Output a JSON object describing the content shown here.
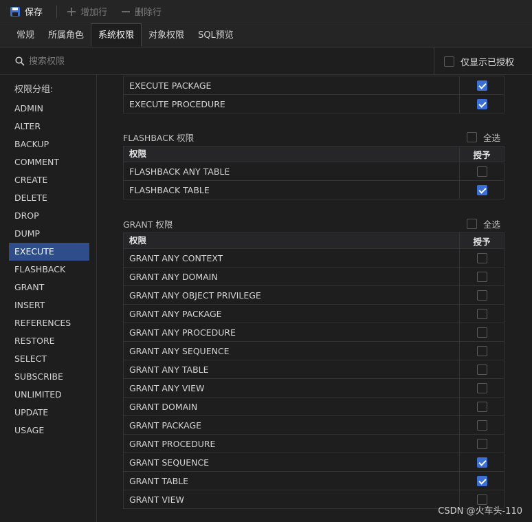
{
  "toolbar": {
    "save_label": "保存",
    "add_row_label": "增加行",
    "delete_row_label": "删除行"
  },
  "tabs": [
    "常规",
    "所属角色",
    "系统权限",
    "对象权限",
    "SQL预览"
  ],
  "active_tab": "系统权限",
  "search": {
    "placeholder": "搜索权限",
    "value": ""
  },
  "only_granted": {
    "label": "仅显示已授权",
    "checked": false
  },
  "sidebar": {
    "title": "权限分组:",
    "items": [
      "ADMIN",
      "ALTER",
      "BACKUP",
      "COMMENT",
      "CREATE",
      "DELETE",
      "DROP",
      "DUMP",
      "EXECUTE",
      "FLASHBACK",
      "GRANT",
      "INSERT",
      "REFERENCES",
      "RESTORE",
      "SELECT",
      "SUBSCRIBE",
      "UNLIMITED",
      "UPDATE",
      "USAGE"
    ],
    "active": "EXECUTE"
  },
  "table_headers": {
    "privilege": "权限",
    "grant": "授予"
  },
  "select_all_label": "全选",
  "execute_tail": {
    "rows": [
      {
        "name": "EXECUTE PACKAGE",
        "granted": true
      },
      {
        "name": "EXECUTE PROCEDURE",
        "granted": true
      }
    ]
  },
  "flashback": {
    "title": "FLASHBACK 权限",
    "select_all": false,
    "rows": [
      {
        "name": "FLASHBACK ANY TABLE",
        "granted": false
      },
      {
        "name": "FLASHBACK TABLE",
        "granted": true
      }
    ]
  },
  "grant": {
    "title": "GRANT 权限",
    "select_all": false,
    "rows": [
      {
        "name": "GRANT ANY CONTEXT",
        "granted": false
      },
      {
        "name": "GRANT ANY DOMAIN",
        "granted": false
      },
      {
        "name": "GRANT ANY OBJECT PRIVILEGE",
        "granted": false
      },
      {
        "name": "GRANT ANY PACKAGE",
        "granted": false
      },
      {
        "name": "GRANT ANY PROCEDURE",
        "granted": false
      },
      {
        "name": "GRANT ANY SEQUENCE",
        "granted": false
      },
      {
        "name": "GRANT ANY TABLE",
        "granted": false
      },
      {
        "name": "GRANT ANY VIEW",
        "granted": false
      },
      {
        "name": "GRANT DOMAIN",
        "granted": false
      },
      {
        "name": "GRANT PACKAGE",
        "granted": false
      },
      {
        "name": "GRANT PROCEDURE",
        "granted": false
      },
      {
        "name": "GRANT SEQUENCE",
        "granted": true
      },
      {
        "name": "GRANT TABLE",
        "granted": true
      },
      {
        "name": "GRANT VIEW",
        "granted": false
      }
    ]
  },
  "watermark": "CSDN @火车头-110",
  "colors": {
    "accent": "#3b6fd8",
    "sidebar_active": "#2f4d8a",
    "background": "#1e1e1f"
  }
}
